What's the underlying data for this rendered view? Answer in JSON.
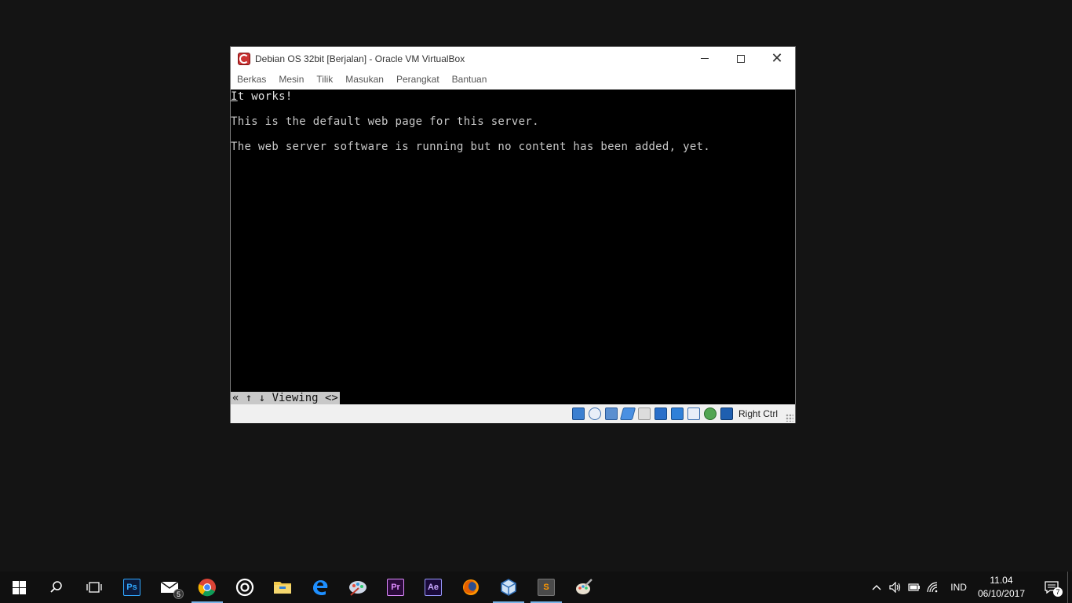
{
  "window": {
    "title": "Debian OS 32bit [Berjalan] - Oracle VM VirtualBox",
    "controls": {
      "minimize": "—",
      "maximize": "☐",
      "close": "✕"
    }
  },
  "menubar": {
    "items": [
      "Berkas",
      "Mesin",
      "Tilik",
      "Masukan",
      "Perangkat",
      "Bantuan"
    ]
  },
  "console": {
    "line1_first_char": "I",
    "line1_rest": "t works!",
    "line2": "This is the default web page for this server.",
    "line3": "The web server software is running but no content has been added, yet.",
    "status": "« ↑ ↓ Viewing <>"
  },
  "statusbar": {
    "icons": [
      "hard-disk-icon",
      "optical-drive-icon",
      "audio-icon",
      "network-icon",
      "usb-icon",
      "shared-folders-icon",
      "display-icon",
      "video-capture-icon",
      "guest-additions-icon",
      "mouse-integration-icon",
      "keyboard-capture-icon"
    ],
    "host_key": "Right Ctrl"
  },
  "taskbar": {
    "mail_badge": "5",
    "photoshop_label": "Ps",
    "premiere_label": "Pr",
    "aftereffects_label": "Ae",
    "sublime_label": "S"
  },
  "tray": {
    "language": "IND",
    "time": "11.04",
    "date": "06/10/2017",
    "notification_count": "7"
  },
  "colors": {
    "desktop": "#141414",
    "taskbar": "#101010",
    "console_bg": "#000000",
    "console_text": "#c8c8c8",
    "active_indicator": "#7ab4e8"
  }
}
